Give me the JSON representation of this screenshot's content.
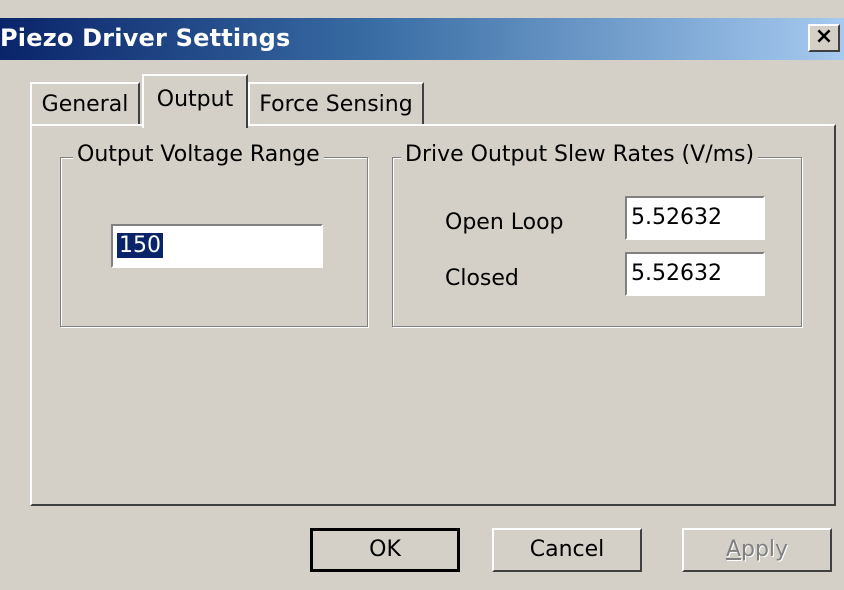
{
  "window": {
    "title": "Piezo Driver Settings",
    "close_label": "×"
  },
  "tabs": [
    {
      "label": "General",
      "active": false
    },
    {
      "label": "Output",
      "active": true
    },
    {
      "label": "Force Sensing",
      "active": false
    }
  ],
  "output_voltage_range": {
    "group_label": "Output Voltage Range",
    "value": "150"
  },
  "slew_rates": {
    "group_label": "Drive Output Slew Rates (V/ms)",
    "open_loop_label": "Open Loop",
    "open_loop_value": "5.52632",
    "closed_label": "Closed",
    "closed_value": "5.52632"
  },
  "buttons": {
    "ok": "OK",
    "cancel": "Cancel",
    "apply_mnemonic": "A",
    "apply_rest": "pply"
  },
  "colors": {
    "title_gradient_start": "#0a246a",
    "title_gradient_end": "#a6caf0",
    "dialog_bg": "#d4d0c8",
    "selection": "#0a246a"
  }
}
